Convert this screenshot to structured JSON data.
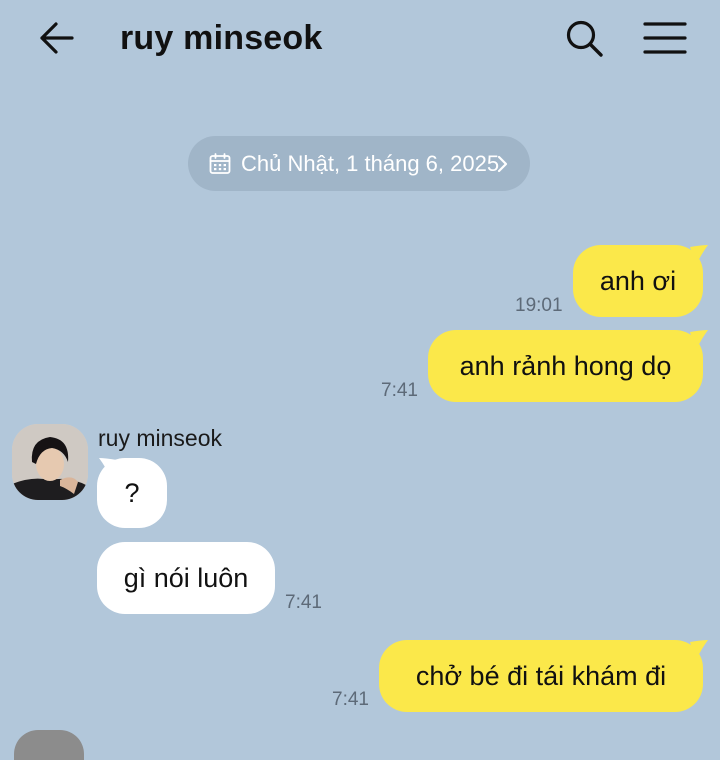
{
  "header": {
    "title": "ruy minseok",
    "icons": {
      "back": "back-arrow-icon",
      "search": "search-icon",
      "menu": "menu-icon"
    }
  },
  "date_divider": {
    "text": "Chủ Nhật, 1 tháng 6, 2025"
  },
  "messages": [
    {
      "from": "me",
      "text": "anh ơi",
      "time": "19:01"
    },
    {
      "from": "me",
      "text": "anh rảnh hong dọ",
      "time": "7:41"
    },
    {
      "from": "them",
      "sender": "ruy minseok",
      "text": "?"
    },
    {
      "from": "them",
      "text": "gì nói luôn",
      "time": "7:41"
    },
    {
      "from": "me",
      "text": "chở bé đi tái khám đi",
      "time": "7:41"
    }
  ],
  "colors": {
    "background": "#b2c7da",
    "my_bubble": "#fbe84a",
    "their_bubble": "#ffffff",
    "time_text": "#5d6a78"
  }
}
